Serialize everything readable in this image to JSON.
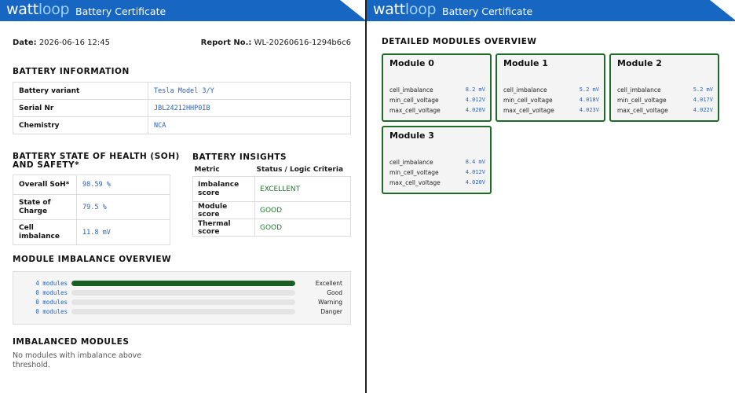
{
  "header": {
    "logo_part1": "watt",
    "logo_part2": "loop",
    "title": "Battery Certificate"
  },
  "meta": {
    "date_label": "Date:",
    "date_value": "2026-06-16 12:45",
    "report_label": "Report No.:",
    "report_value": "WL-20260616-1294b6c6"
  },
  "battery_info": {
    "title": "BATTERY INFORMATION",
    "rows": [
      {
        "label": "Battery variant",
        "value": "Tesla Model 3/Y"
      },
      {
        "label": "Serial Nr",
        "value": "JBL24212HHP0IB"
      },
      {
        "label": "Chemistry",
        "value": "NCA"
      }
    ]
  },
  "soh": {
    "title_line1": "BATTERY STATE OF HEALTH (SOH)",
    "title_line2": "AND SAFETY*",
    "rows": [
      {
        "label": "Overall SoH*",
        "value": "98.59 %"
      },
      {
        "label_line1": "State of",
        "label_line2": "Charge",
        "value": "79.5 %"
      },
      {
        "label_line1": "Cell",
        "label_line2": "imbalance",
        "value": "11.8 mV"
      }
    ]
  },
  "insights": {
    "title": "BATTERY INSIGHTS",
    "col_metric": "Metric",
    "col_status": "Status / Logic Criteria",
    "rows": [
      {
        "label_line1": "Imbalance",
        "label_line2": "score",
        "value": "EXCELLENT"
      },
      {
        "label": "Module score",
        "value": "GOOD"
      },
      {
        "label": "Thermal score",
        "value": "GOOD"
      }
    ]
  },
  "imbalance_overview": {
    "title": "MODULE IMBALANCE OVERVIEW",
    "rows": [
      {
        "count": "4 modules",
        "label": "Excellent",
        "fraction": 1.0
      },
      {
        "count": "0 modules",
        "label": "Good",
        "fraction": 0
      },
      {
        "count": "0 modules",
        "label": "Warning",
        "fraction": 0
      },
      {
        "count": "0 modules",
        "label": "Danger",
        "fraction": 0
      }
    ]
  },
  "imbalanced_modules": {
    "title": "IMBALANCED MODULES",
    "note": "No modules with imbalance above threshold."
  },
  "detailed": {
    "title": "DETAILED MODULES OVERVIEW",
    "modules": [
      {
        "name": "Module 0",
        "rows": [
          {
            "label": "cell_imbalance",
            "value": "8.2 mV"
          },
          {
            "label": "min_cell_voltage",
            "value": "4.012V"
          },
          {
            "label": "max_cell_voltage",
            "value": "4.020V"
          }
        ]
      },
      {
        "name": "Module 1",
        "rows": [
          {
            "label": "cell_imbalance",
            "value": "5.2 mV"
          },
          {
            "label": "min_cell_voltage",
            "value": "4.018V"
          },
          {
            "label": "max_cell_voltage",
            "value": "4.023V"
          }
        ]
      },
      {
        "name": "Module 2",
        "rows": [
          {
            "label": "cell_imbalance",
            "value": "5.2 mV"
          },
          {
            "label": "min_cell_voltage",
            "value": "4.017V"
          },
          {
            "label": "max_cell_voltage",
            "value": "4.022V"
          }
        ]
      },
      {
        "name": "Module 3",
        "rows": [
          {
            "label": "cell_imbalance",
            "value": "8.4 mV"
          },
          {
            "label": "min_cell_voltage",
            "value": "4.012V"
          },
          {
            "label": "max_cell_voltage",
            "value": "4.020V"
          }
        ]
      }
    ]
  },
  "colors": {
    "header_blue": "#1666c2",
    "logo_accent": "#9fd0ff",
    "value_blue": "#2a62b8",
    "status_green": "#1e7a2a",
    "bar_green": "#1a5e24"
  }
}
